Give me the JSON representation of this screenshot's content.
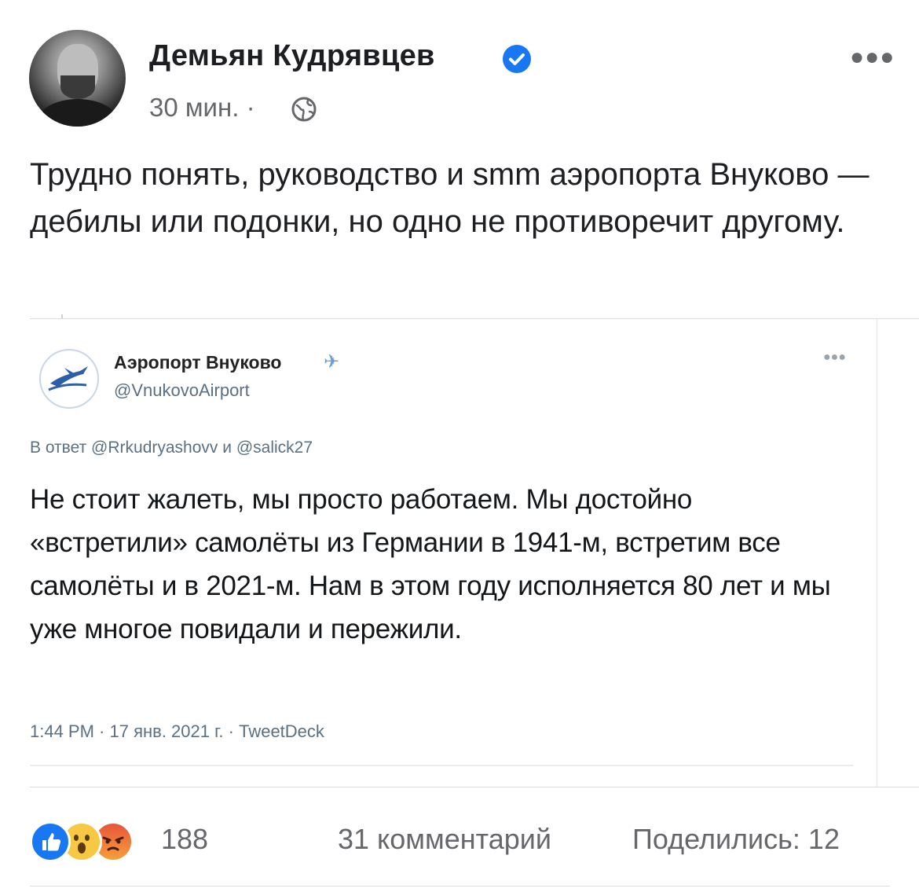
{
  "post": {
    "author": "Демьян Кудрявцев",
    "time": "30 мин.",
    "separator": "·",
    "text": "Трудно понять, руководство и smm аэропорта Внуково — дебилы или подонки, но одно не противоречит другому.",
    "more_icon": "more-horizontal-icon",
    "verified_icon": "verified-badge-icon",
    "privacy_icon": "globe-icon"
  },
  "tweet": {
    "name": "Аэропорт Внуково",
    "handle": "@VnukovoAirport",
    "reply_prefix": "В ответ",
    "reply_user1": "@Rrkudryashovv",
    "reply_and": "и",
    "reply_user2": "@salick27",
    "text": "Не стоит жалеть, мы просто работаем. Мы достойно «встретили» самолёты из Германии в 1941-м, встретим все самолёты и в 2021-м. Нам в этом году исполняется 80 лет и мы уже многое повидали и пережили.",
    "timestamp": "1:44 PM · 17 янв. 2021 г. · TweetDeck",
    "plane_glyph": "✈"
  },
  "footer": {
    "reactions_count": "188",
    "comments": "31 комментарий",
    "shares": "Поделились: 12"
  },
  "colors": {
    "facebook_blue": "#1877f2",
    "secondary_text": "#65676b",
    "twitter_secondary": "#5b7083"
  }
}
